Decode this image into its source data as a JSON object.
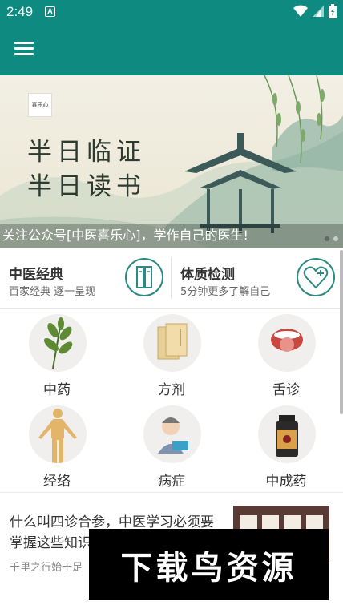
{
  "status_bar": {
    "time": "2:49",
    "notification_letter": "A"
  },
  "banner": {
    "logo_text": "喜乐心",
    "title_line1": "半日临证",
    "title_line2": "半日读书",
    "caption": "关注公众号[中医喜乐心]，学作自己的医生!"
  },
  "features": [
    {
      "title": "中医经典",
      "subtitle": "百家经典 逐一呈现",
      "icon": "scroll-icon"
    },
    {
      "title": "体质检测",
      "subtitle": "5分钟更多了解自己",
      "icon": "heart-plus-icon"
    }
  ],
  "categories": [
    {
      "label": "中药",
      "icon": "herb-icon"
    },
    {
      "label": "方剂",
      "icon": "prescription-icon"
    },
    {
      "label": "舌诊",
      "icon": "tongue-icon"
    },
    {
      "label": "经络",
      "icon": "meridian-icon"
    },
    {
      "label": "病症",
      "icon": "patient-icon"
    },
    {
      "label": "中成药",
      "icon": "medicine-bottle-icon"
    }
  ],
  "article": {
    "title": "什么叫四诊合参，中医学习必须要掌握这些知识",
    "source": "千里之行始于足"
  },
  "watermark_text": "下载鸟资源",
  "colors": {
    "primary": "#0f8a80",
    "text": "#333333"
  }
}
